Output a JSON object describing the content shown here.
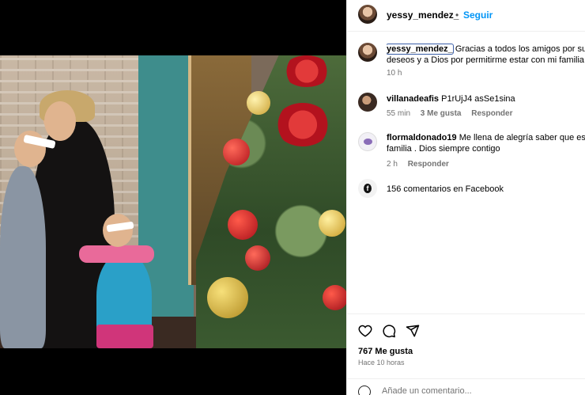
{
  "post": {
    "username": "yessy_mendez_",
    "follow_label": "Seguir",
    "separator": "•"
  },
  "caption": {
    "username": "yessy_mendez_",
    "line1": "Gracias a todos los amigos por su",
    "line2": "deseos y a Dios por permitirme estar con mi familia",
    "time": "10 h"
  },
  "comments": [
    {
      "username": "villanadeafis",
      "text": "P1rUjJ4 asSe1sina",
      "time": "55 min",
      "likes": "3 Me gusta",
      "reply": "Responder"
    },
    {
      "username": "flormaldonado19",
      "line1": "Me llena de alegría saber que est",
      "line2": "familia . Dios siempre contigo",
      "time": "2 h",
      "reply": "Responder"
    }
  ],
  "facebook_comments": "156 comentarios en Facebook",
  "likes": "767 Me gusta",
  "posted": "Hace 10 horas",
  "add_comment_placeholder": "Añade un comentario...",
  "icons": {
    "like": "heart-icon",
    "comment": "comment-bubble-icon",
    "share": "paper-plane-icon",
    "facebook": "facebook-icon",
    "emoji": "smiley-icon"
  },
  "colors": {
    "link_blue": "#0095f6",
    "muted": "#737373"
  }
}
